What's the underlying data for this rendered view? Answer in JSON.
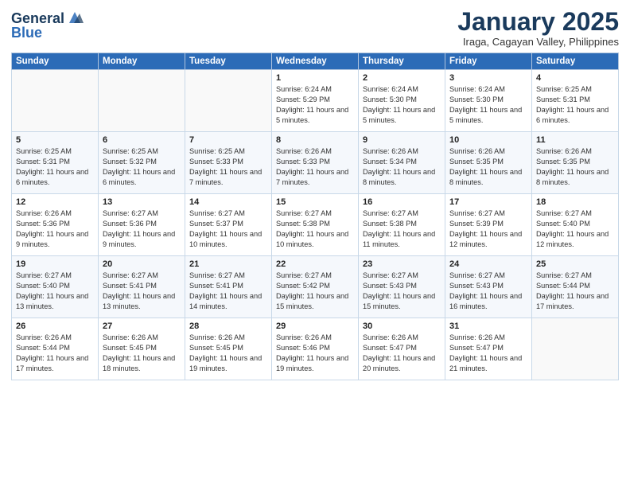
{
  "header": {
    "logo_line1": "General",
    "logo_line2": "Blue",
    "month": "January 2025",
    "location": "Iraga, Cagayan Valley, Philippines"
  },
  "weekdays": [
    "Sunday",
    "Monday",
    "Tuesday",
    "Wednesday",
    "Thursday",
    "Friday",
    "Saturday"
  ],
  "weeks": [
    [
      {
        "day": "",
        "sunrise": "",
        "sunset": "",
        "daylight": ""
      },
      {
        "day": "",
        "sunrise": "",
        "sunset": "",
        "daylight": ""
      },
      {
        "day": "",
        "sunrise": "",
        "sunset": "",
        "daylight": ""
      },
      {
        "day": "1",
        "sunrise": "Sunrise: 6:24 AM",
        "sunset": "Sunset: 5:29 PM",
        "daylight": "Daylight: 11 hours and 5 minutes."
      },
      {
        "day": "2",
        "sunrise": "Sunrise: 6:24 AM",
        "sunset": "Sunset: 5:30 PM",
        "daylight": "Daylight: 11 hours and 5 minutes."
      },
      {
        "day": "3",
        "sunrise": "Sunrise: 6:24 AM",
        "sunset": "Sunset: 5:30 PM",
        "daylight": "Daylight: 11 hours and 5 minutes."
      },
      {
        "day": "4",
        "sunrise": "Sunrise: 6:25 AM",
        "sunset": "Sunset: 5:31 PM",
        "daylight": "Daylight: 11 hours and 6 minutes."
      }
    ],
    [
      {
        "day": "5",
        "sunrise": "Sunrise: 6:25 AM",
        "sunset": "Sunset: 5:31 PM",
        "daylight": "Daylight: 11 hours and 6 minutes."
      },
      {
        "day": "6",
        "sunrise": "Sunrise: 6:25 AM",
        "sunset": "Sunset: 5:32 PM",
        "daylight": "Daylight: 11 hours and 6 minutes."
      },
      {
        "day": "7",
        "sunrise": "Sunrise: 6:25 AM",
        "sunset": "Sunset: 5:33 PM",
        "daylight": "Daylight: 11 hours and 7 minutes."
      },
      {
        "day": "8",
        "sunrise": "Sunrise: 6:26 AM",
        "sunset": "Sunset: 5:33 PM",
        "daylight": "Daylight: 11 hours and 7 minutes."
      },
      {
        "day": "9",
        "sunrise": "Sunrise: 6:26 AM",
        "sunset": "Sunset: 5:34 PM",
        "daylight": "Daylight: 11 hours and 8 minutes."
      },
      {
        "day": "10",
        "sunrise": "Sunrise: 6:26 AM",
        "sunset": "Sunset: 5:35 PM",
        "daylight": "Daylight: 11 hours and 8 minutes."
      },
      {
        "day": "11",
        "sunrise": "Sunrise: 6:26 AM",
        "sunset": "Sunset: 5:35 PM",
        "daylight": "Daylight: 11 hours and 8 minutes."
      }
    ],
    [
      {
        "day": "12",
        "sunrise": "Sunrise: 6:26 AM",
        "sunset": "Sunset: 5:36 PM",
        "daylight": "Daylight: 11 hours and 9 minutes."
      },
      {
        "day": "13",
        "sunrise": "Sunrise: 6:27 AM",
        "sunset": "Sunset: 5:36 PM",
        "daylight": "Daylight: 11 hours and 9 minutes."
      },
      {
        "day": "14",
        "sunrise": "Sunrise: 6:27 AM",
        "sunset": "Sunset: 5:37 PM",
        "daylight": "Daylight: 11 hours and 10 minutes."
      },
      {
        "day": "15",
        "sunrise": "Sunrise: 6:27 AM",
        "sunset": "Sunset: 5:38 PM",
        "daylight": "Daylight: 11 hours and 10 minutes."
      },
      {
        "day": "16",
        "sunrise": "Sunrise: 6:27 AM",
        "sunset": "Sunset: 5:38 PM",
        "daylight": "Daylight: 11 hours and 11 minutes."
      },
      {
        "day": "17",
        "sunrise": "Sunrise: 6:27 AM",
        "sunset": "Sunset: 5:39 PM",
        "daylight": "Daylight: 11 hours and 12 minutes."
      },
      {
        "day": "18",
        "sunrise": "Sunrise: 6:27 AM",
        "sunset": "Sunset: 5:40 PM",
        "daylight": "Daylight: 11 hours and 12 minutes."
      }
    ],
    [
      {
        "day": "19",
        "sunrise": "Sunrise: 6:27 AM",
        "sunset": "Sunset: 5:40 PM",
        "daylight": "Daylight: 11 hours and 13 minutes."
      },
      {
        "day": "20",
        "sunrise": "Sunrise: 6:27 AM",
        "sunset": "Sunset: 5:41 PM",
        "daylight": "Daylight: 11 hours and 13 minutes."
      },
      {
        "day": "21",
        "sunrise": "Sunrise: 6:27 AM",
        "sunset": "Sunset: 5:41 PM",
        "daylight": "Daylight: 11 hours and 14 minutes."
      },
      {
        "day": "22",
        "sunrise": "Sunrise: 6:27 AM",
        "sunset": "Sunset: 5:42 PM",
        "daylight": "Daylight: 11 hours and 15 minutes."
      },
      {
        "day": "23",
        "sunrise": "Sunrise: 6:27 AM",
        "sunset": "Sunset: 5:43 PM",
        "daylight": "Daylight: 11 hours and 15 minutes."
      },
      {
        "day": "24",
        "sunrise": "Sunrise: 6:27 AM",
        "sunset": "Sunset: 5:43 PM",
        "daylight": "Daylight: 11 hours and 16 minutes."
      },
      {
        "day": "25",
        "sunrise": "Sunrise: 6:27 AM",
        "sunset": "Sunset: 5:44 PM",
        "daylight": "Daylight: 11 hours and 17 minutes."
      }
    ],
    [
      {
        "day": "26",
        "sunrise": "Sunrise: 6:26 AM",
        "sunset": "Sunset: 5:44 PM",
        "daylight": "Daylight: 11 hours and 17 minutes."
      },
      {
        "day": "27",
        "sunrise": "Sunrise: 6:26 AM",
        "sunset": "Sunset: 5:45 PM",
        "daylight": "Daylight: 11 hours and 18 minutes."
      },
      {
        "day": "28",
        "sunrise": "Sunrise: 6:26 AM",
        "sunset": "Sunset: 5:45 PM",
        "daylight": "Daylight: 11 hours and 19 minutes."
      },
      {
        "day": "29",
        "sunrise": "Sunrise: 6:26 AM",
        "sunset": "Sunset: 5:46 PM",
        "daylight": "Daylight: 11 hours and 19 minutes."
      },
      {
        "day": "30",
        "sunrise": "Sunrise: 6:26 AM",
        "sunset": "Sunset: 5:47 PM",
        "daylight": "Daylight: 11 hours and 20 minutes."
      },
      {
        "day": "31",
        "sunrise": "Sunrise: 6:26 AM",
        "sunset": "Sunset: 5:47 PM",
        "daylight": "Daylight: 11 hours and 21 minutes."
      },
      {
        "day": "",
        "sunrise": "",
        "sunset": "",
        "daylight": ""
      }
    ]
  ]
}
